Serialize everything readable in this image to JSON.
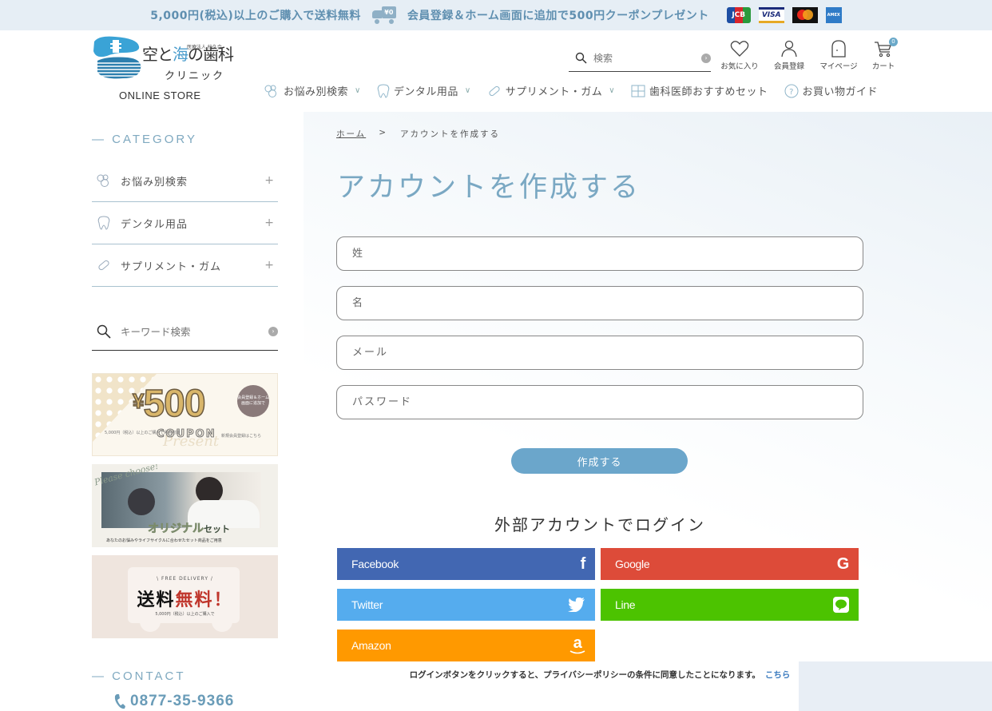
{
  "topbar": {
    "shipping_msg": "5,000円(税込)以上のご購入で送料無料",
    "truck_label": "¥0",
    "coupon_msg": "会員登録＆ホーム画面に追加で500円クーポンプレゼント",
    "cards": [
      "JCB",
      "VISA",
      "Mastercard",
      "AMEX"
    ]
  },
  "logo": {
    "corp": "医療法人 紗久会",
    "name_part1": "空と",
    "name_accent": "海",
    "name_part2": "の歯科",
    "name_line2": "クリニック",
    "store": "ONLINE STORE"
  },
  "header": {
    "search_placeholder": "検索",
    "icons": [
      {
        "name": "favorites",
        "label": "お気に入り",
        "icon": "heart-icon"
      },
      {
        "name": "register",
        "label": "会員登録",
        "icon": "user-icon"
      },
      {
        "name": "mypage",
        "label": "マイページ",
        "icon": "door-icon"
      },
      {
        "name": "cart",
        "label": "カート",
        "icon": "cart-icon",
        "badge": "0"
      }
    ],
    "nav": [
      {
        "label": "お悩み別検索",
        "icon": "bubbles-icon",
        "dropdown": true
      },
      {
        "label": "デンタル用品",
        "icon": "tooth-icon",
        "dropdown": true
      },
      {
        "label": "サプリメント・ガム",
        "icon": "capsule-icon",
        "dropdown": true
      },
      {
        "label": "歯科医師おすすめセット",
        "icon": "gift-icon",
        "dropdown": false
      },
      {
        "label": "お買い物ガイド",
        "icon": "question-icon",
        "dropdown": false
      }
    ]
  },
  "sidebar": {
    "category_title": "— CATEGORY",
    "categories": [
      {
        "label": "お悩み別検索",
        "icon": "bubbles-icon"
      },
      {
        "label": "デンタル用品",
        "icon": "tooth-icon"
      },
      {
        "label": "サプリメント・ガム",
        "icon": "capsule-icon"
      }
    ],
    "keyword_placeholder": "キーワード検索",
    "banners": {
      "coupon": {
        "amount": "500",
        "currency": "¥",
        "word": "COUPON",
        "script": "Present",
        "badge": "会員登録＆ホーム画面に追加で",
        "note": "5,000円（税込）以上のご購入で利用可能",
        "link": "新規会員登録はこちら"
      },
      "set": {
        "script": "Please choose!",
        "title": "オリジナル",
        "title_suffix": "セット",
        "sub": "あなたのお悩みやライフサイクルに合わせたセット商品をご用意"
      },
      "delivery": {
        "eyebrow": "\\ FREE DELIVERY /",
        "title_a": "送料",
        "title_b": "無料！",
        "sub": "5,000円（税込）以上のご購入で"
      }
    },
    "contact_title": "— CONTACT",
    "phone": "0877-35-9366"
  },
  "main": {
    "breadcrumb": {
      "home": "ホーム",
      "sep": ">",
      "current": "アカウントを作成する"
    },
    "title": "アカウントを作成する",
    "fields": [
      {
        "name": "last-name",
        "placeholder": "姓"
      },
      {
        "name": "first-name",
        "placeholder": "名"
      },
      {
        "name": "email",
        "placeholder": "メール"
      },
      {
        "name": "password",
        "placeholder": "パスワード"
      }
    ],
    "submit_label": "作成する",
    "external_title": "外部アカウントでログイン",
    "social": [
      {
        "label": "Facebook",
        "color": "#4267b2"
      },
      {
        "label": "Google",
        "color": "#dd4b39"
      },
      {
        "label": "Twitter",
        "color": "#55acee"
      },
      {
        "label": "Line",
        "color": "#4cc300"
      },
      {
        "label": "Amazon",
        "color": "#ff9900"
      }
    ],
    "privacy_text": "ログインボタンをクリックすると、プライバシーポリシーの条件に同意したことになります。",
    "privacy_link": "こちら"
  },
  "colors": {
    "accent": "#7aa8c3",
    "button": "#6ba6cb",
    "topbar_bg": "#e6eef5"
  }
}
